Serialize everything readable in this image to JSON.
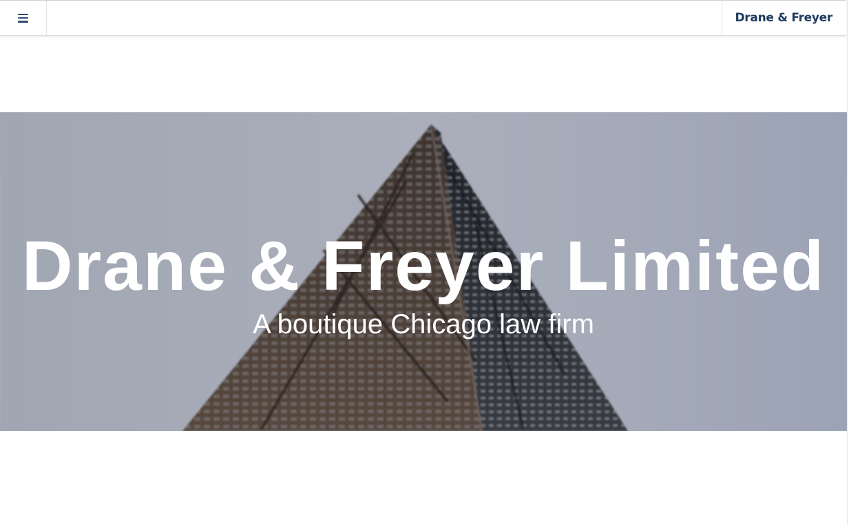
{
  "header": {
    "menu_icon": "hamburger-menu-icon",
    "brand_label": "Drane & Freyer",
    "brand_color": "#1f3a5f"
  },
  "hero": {
    "title": "Drane & Freyer Limited",
    "subtitle": "A boutique Chicago law firm",
    "background_image": "skyscraper-photo",
    "text_color": "#ffffff"
  }
}
